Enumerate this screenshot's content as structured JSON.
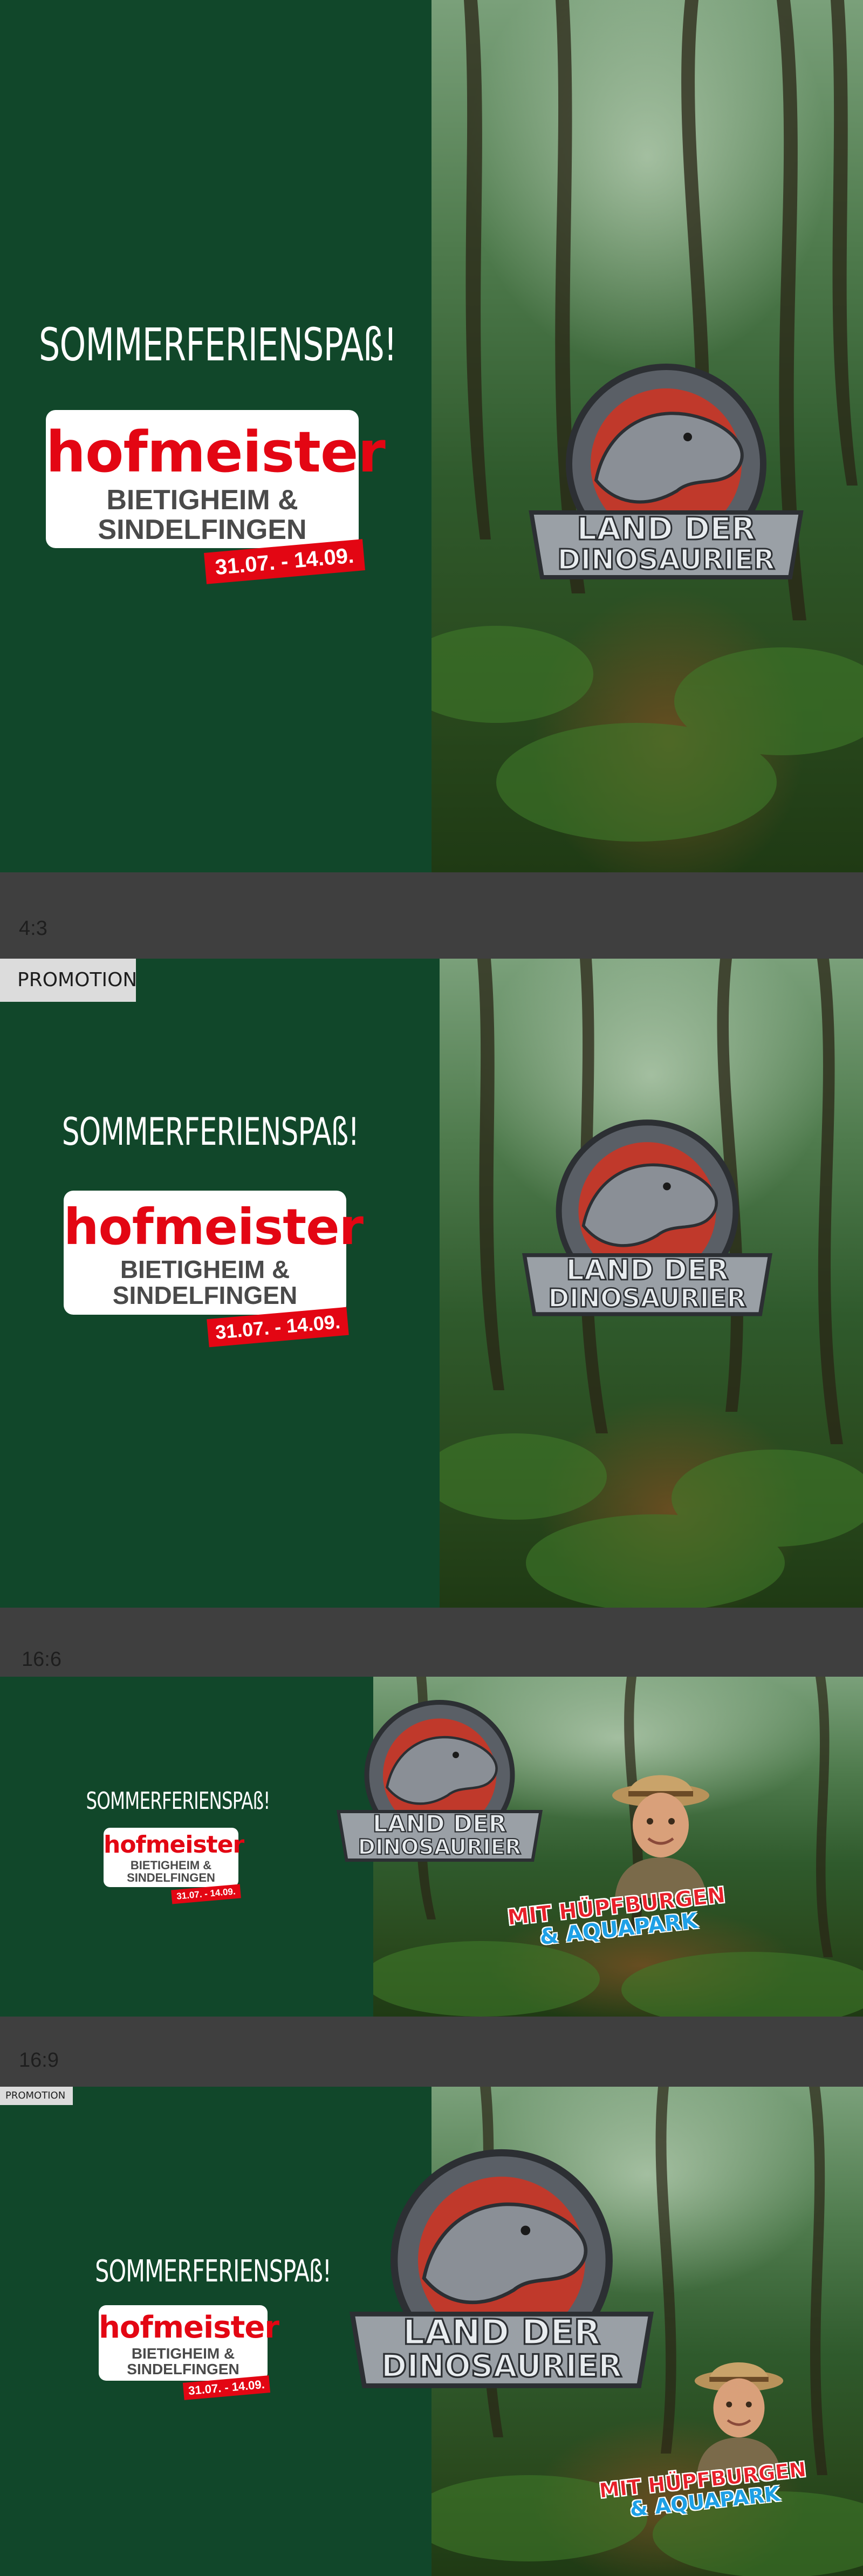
{
  "headline": "SOMMERFERIENSPAß!",
  "brand": {
    "name": "hofmeister",
    "location_line1": "BIETIGHEIM &",
    "location_line2": "SINDELFINGEN",
    "dates": "31.07. - 14.09."
  },
  "dino_logo": {
    "line1": "LAND DER",
    "line2": "DINOSAURIER"
  },
  "extras": {
    "line1": "MIT HÜPFBURGEN",
    "line2": "& AQUAPARK"
  },
  "promo_label": "PROMOTION",
  "formats": {
    "f1": "4:3",
    "f2": "16:6",
    "f3": "16:9"
  },
  "colors": {
    "panel_green": "#11472a",
    "brand_red": "#e30613",
    "aqua_blue": "#1ea0e6",
    "separator_gray": "#3f3f3f"
  }
}
